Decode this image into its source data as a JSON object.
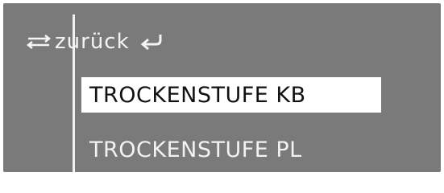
{
  "back_row": {
    "scroll_icon": "scroll-arrows-icon",
    "label": "zurück",
    "return_icon": "return-arrow-icon"
  },
  "menu": {
    "items": [
      {
        "label": "TROCKENSTUFE KB",
        "selected": true
      },
      {
        "label": "TROCKENSTUFE PL",
        "selected": false
      }
    ]
  },
  "colors": {
    "display_background": "#7a7a7a",
    "text": "#f2f2f2",
    "selected_background": "#ffffff",
    "selected_text": "#111111"
  }
}
